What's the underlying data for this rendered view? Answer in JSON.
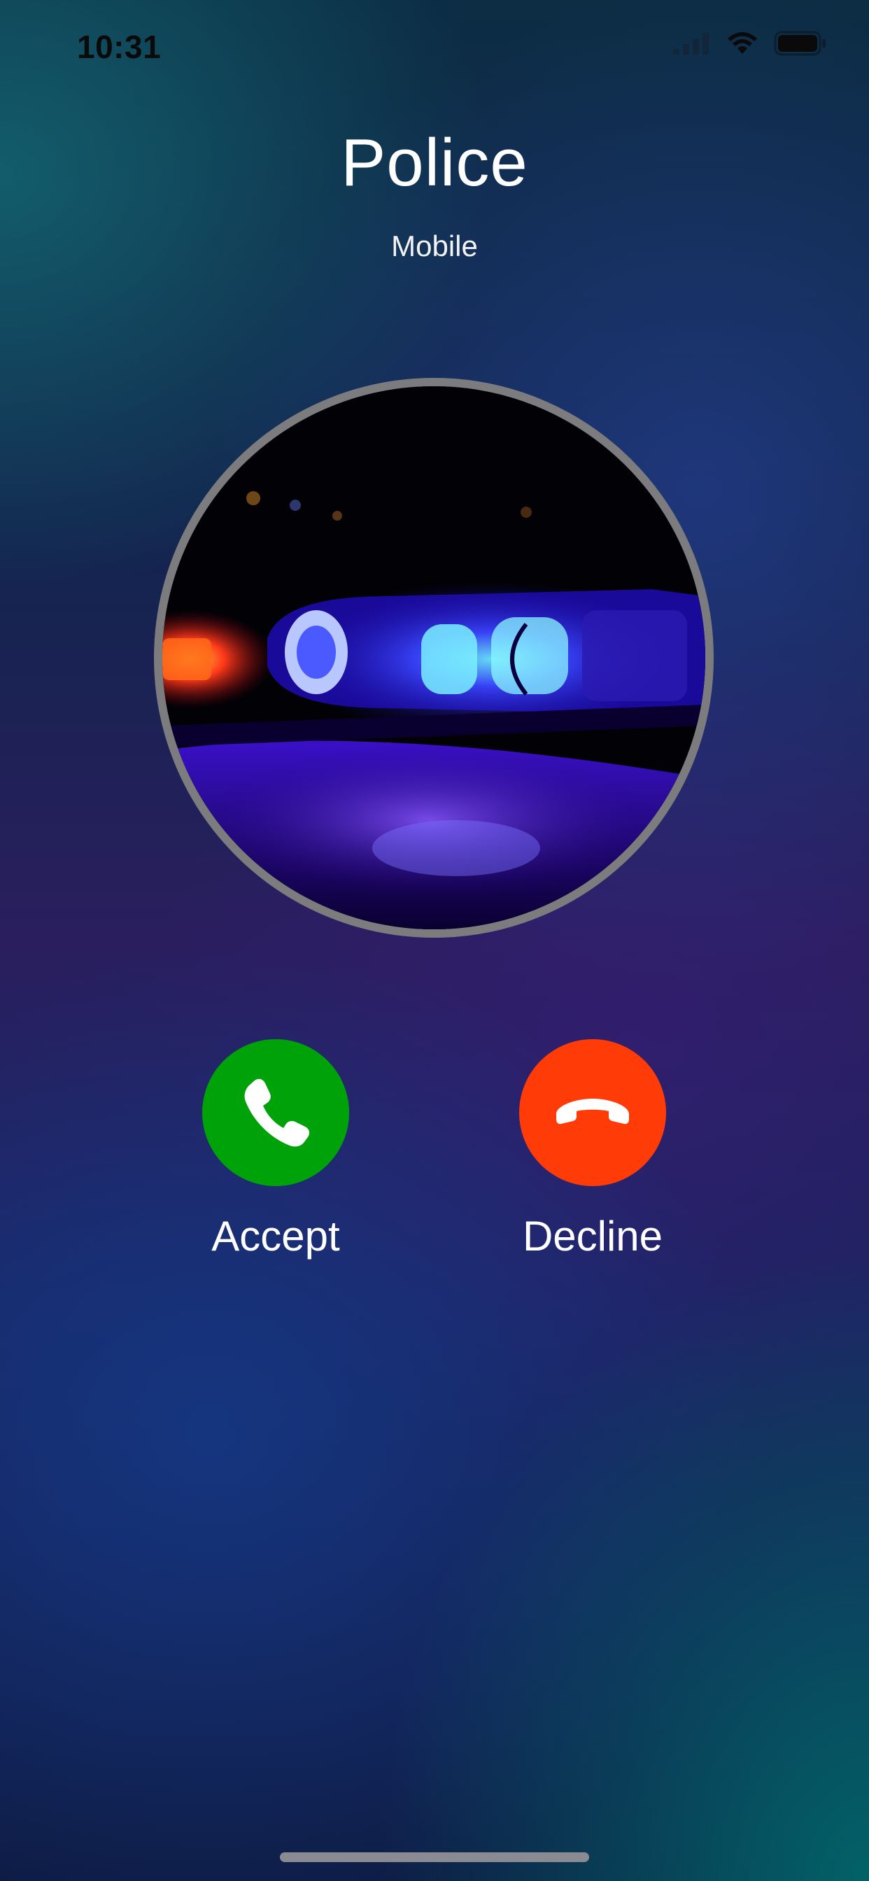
{
  "status_bar": {
    "time": "10:31",
    "icons": [
      "signal-icon",
      "wifi-icon",
      "battery-icon"
    ]
  },
  "caller": {
    "name": "Police",
    "type": "Mobile",
    "avatar": "police-lights-photo"
  },
  "actions": {
    "accept": {
      "label": "Accept",
      "icon": "phone-icon",
      "color": "#00a20a"
    },
    "decline": {
      "label": "Decline",
      "icon": "hang-up-icon",
      "color": "#ff3c08"
    }
  }
}
